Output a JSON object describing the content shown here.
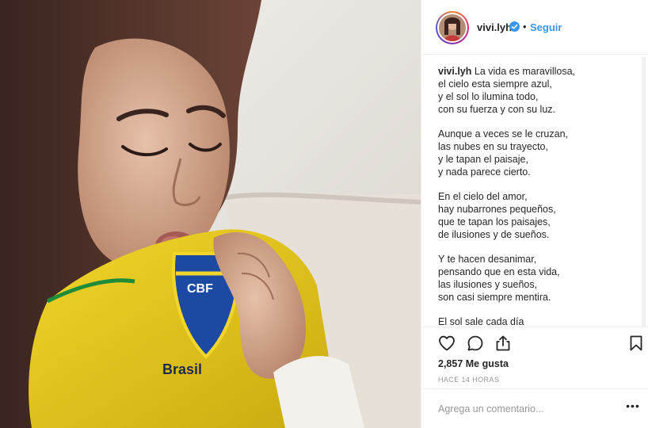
{
  "post": {
    "image_alt": "Mujer besando el escudo CBF de una camiseta amarilla de Brasil",
    "shirt_badge_text": "CBF",
    "shirt_brand_text": "Brasil"
  },
  "header": {
    "username": "vivi.lyh",
    "dot": "•",
    "follow_label": "Seguir",
    "avatar_icon": "profile-photo",
    "verified_icon": "verified-badge-icon"
  },
  "caption": {
    "username": "vivi.lyh",
    "stanzas": [
      "La vida es maravillosa,\nel cielo esta siempre azul,\ny el sol lo ilumina todo,\ncon su fuerza y con su luz.",
      "Aunque a veces se le cruzan,\nlas nubes en su trayecto,\ny le tapan el paisaje,\ny nada parece cierto.",
      "En el cielo del amor,\nhay nubarrones pequeños,\nque te tapan los paisajes,\nde ilusiones y de sueños.",
      "Y te hacen desanimar,\npensando que en esta vida,\nlas ilusiones y sueños,\nson casi siempre mentira.",
      "El sol sale cada día"
    ]
  },
  "actions": {
    "like_icon": "heart-icon",
    "comment_icon": "comment-icon",
    "share_icon": "share-icon",
    "save_icon": "bookmark-icon"
  },
  "likes_text": "2,857 Me gusta",
  "timestamp": "HACE 14 HORAS",
  "comment": {
    "placeholder": "Agrega un comentario...",
    "more_label": "•••"
  },
  "colors": {
    "accent": "#3897f0",
    "text": "#262626",
    "muted": "#999999",
    "border": "#efefef"
  }
}
